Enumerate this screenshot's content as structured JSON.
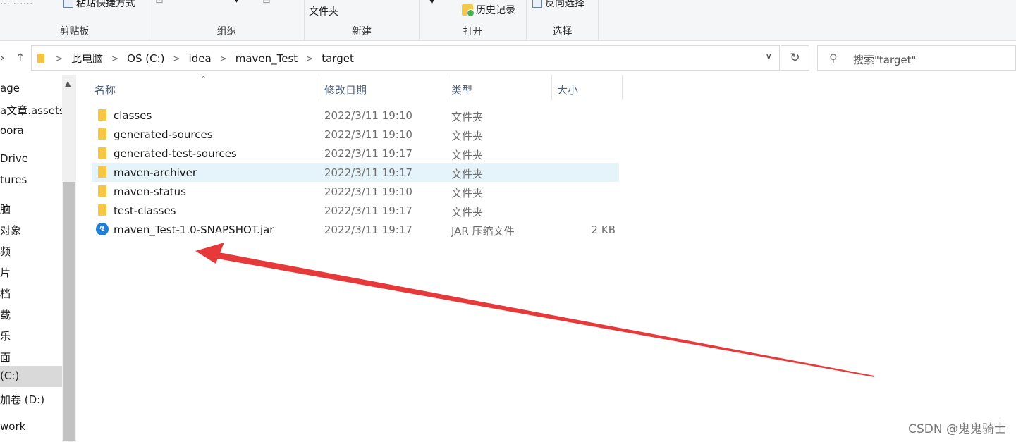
{
  "ribbon": {
    "clipboard": {
      "paste_shortcut": "粘贴快捷方式",
      "label": "剪贴板"
    },
    "organize": {
      "label": "组织"
    },
    "new": {
      "folder": "文件夹",
      "label": "新建"
    },
    "open": {
      "history": "历史记录",
      "label": "打开"
    },
    "select": {
      "invert": "反向选择",
      "label": "选择"
    }
  },
  "address": {
    "crumbs": [
      "此电脑",
      "OS (C:)",
      "idea",
      "maven_Test",
      "target"
    ]
  },
  "search": {
    "placeholder": "搜索\"target\""
  },
  "nav": {
    "items": [
      "age",
      "a文章.assets",
      "oora",
      "Drive",
      "tures",
      "脑",
      "对象",
      "频",
      "片",
      "档",
      "载",
      "乐",
      "面",
      "(C:)",
      "加卷 (D:)",
      "work"
    ],
    "selected": "(C:)"
  },
  "columns": {
    "name": "名称",
    "date": "修改日期",
    "type": "类型",
    "size": "大小"
  },
  "files": [
    {
      "name": "classes",
      "date": "2022/3/11 19:10",
      "type": "文件夹",
      "size": "",
      "icon": "folder-icon"
    },
    {
      "name": "generated-sources",
      "date": "2022/3/11 19:10",
      "type": "文件夹",
      "size": "",
      "icon": "folder-icon"
    },
    {
      "name": "generated-test-sources",
      "date": "2022/3/11 19:17",
      "type": "文件夹",
      "size": "",
      "icon": "folder-icon"
    },
    {
      "name": "maven-archiver",
      "date": "2022/3/11 19:17",
      "type": "文件夹",
      "size": "",
      "icon": "folder-icon"
    },
    {
      "name": "maven-status",
      "date": "2022/3/11 19:10",
      "type": "文件夹",
      "size": "",
      "icon": "folder-icon"
    },
    {
      "name": "test-classes",
      "date": "2022/3/11 19:17",
      "type": "文件夹",
      "size": "",
      "icon": "folder-icon"
    },
    {
      "name": "maven_Test-1.0-SNAPSHOT.jar",
      "date": "2022/3/11 19:17",
      "type": "JAR 压缩文件",
      "size": "2 KB",
      "icon": "jar-file-icon"
    }
  ],
  "highlighted_row": "maven-archiver",
  "colors": {
    "arrow": "#e8393a",
    "highlight": "#e5f3fb",
    "folder": "#f6c744"
  },
  "watermark": "CSDN @鬼鬼骑士"
}
